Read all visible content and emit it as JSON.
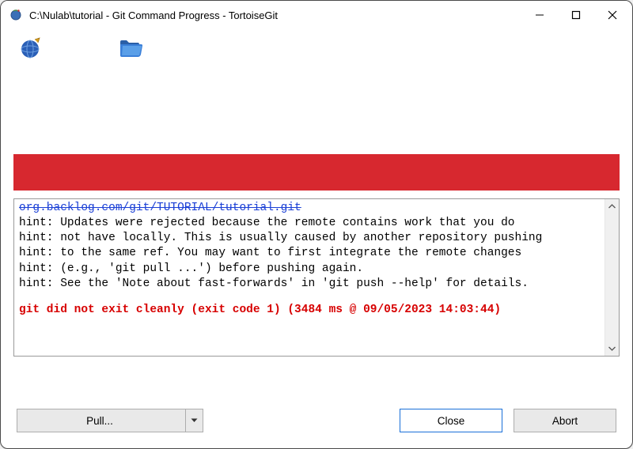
{
  "window": {
    "title": "C:\\Nulab\\tutorial - Git Command Progress - TortoiseGit"
  },
  "toolbar": {
    "icons": {
      "globe": "globe-icon",
      "folder": "folder-icon"
    }
  },
  "log": {
    "url_line": "org.backlog.com/git/TUTORIAL/tutorial.git",
    "hint_lines": [
      "hint: Updates were rejected because the remote contains work that you do",
      "hint: not have locally. This is usually caused by another repository pushing",
      "hint: to the same ref. You may want to first integrate the remote changes",
      "hint: (e.g., 'git pull ...') before pushing again.",
      "hint: See the 'Note about fast-forwards' in 'git push --help' for details."
    ],
    "error_line": "git did not exit cleanly (exit code 1) (3484 ms @ 09/05/2023 14:03:44)"
  },
  "buttons": {
    "pull": "Pull...",
    "close": "Close",
    "abort": "Abort"
  },
  "colors": {
    "error_bar": "#d7282f",
    "error_text": "#d70000",
    "link_text": "#1a3fd6",
    "focus_border": "#1a6fd8"
  }
}
